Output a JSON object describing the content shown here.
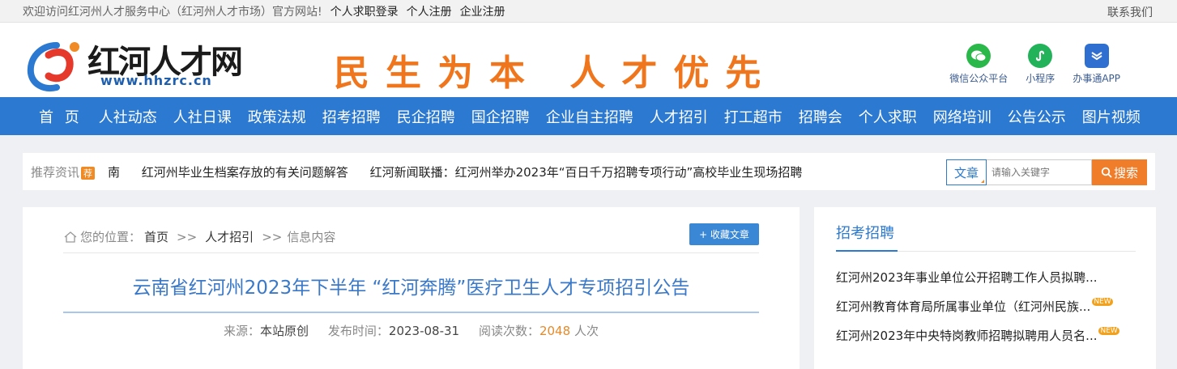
{
  "topbar": {
    "welcome": "欢迎访问红河州人才服务中心（红河州人才市场）官方网站!",
    "links": [
      "个人求职登录",
      "个人注册",
      "企业注册"
    ],
    "contact": "联系我们"
  },
  "header": {
    "logo_name": "红河人才网",
    "logo_site": "www.hhzrc.cn",
    "slogan": "民生为本 人才优先",
    "apps": [
      {
        "label": "微信公众平台",
        "icon": "wechat-icon",
        "color": "#2bb84a"
      },
      {
        "label": "小程序",
        "icon": "mini-program-icon",
        "color": "#22b35a"
      },
      {
        "label": "办事通APP",
        "icon": "app-icon",
        "color": "#2f6fd0"
      }
    ]
  },
  "nav": [
    "首 页",
    "人社动态",
    "人社日课",
    "政策法规",
    "招考招聘",
    "民企招聘",
    "国企招聘",
    "企业自主招聘",
    "人才招引",
    "打工超市",
    "招聘会",
    "个人求职",
    "网络培训",
    "公告公示",
    "图片视频"
  ],
  "recommend": {
    "label": "推荐资讯",
    "tag": "荐",
    "items": [
      "南",
      "红河州毕业生档案存放的有关问题解答",
      "红河新闻联播：红河州举办2023年“百日千万招聘专项行动”高校毕业生现场招聘"
    ]
  },
  "search": {
    "category": "文章",
    "placeholder": "请输入关键字",
    "button": "搜索"
  },
  "article": {
    "breadcrumb_prefix": "您的位置：",
    "breadcrumb": [
      "首页",
      "人才招引",
      "信息内容"
    ],
    "separator": ">>",
    "fav_button": "+ 收藏文章",
    "title": "云南省红河州2023年下半年 “红河奔腾”医疗卫生人才专项招引公告",
    "source_label": "来源：",
    "source": "本站原创",
    "date_label": "发布时间：",
    "date": "2023-08-31",
    "views_label": "阅读次数：",
    "views": "2048",
    "views_unit": "人次"
  },
  "side": {
    "title": "招考招聘",
    "new_tag": "NEW",
    "items": [
      {
        "text": "红河州2023年事业单位公开招聘工作人员拟聘...",
        "new": false
      },
      {
        "text": "红河州教育体育局所属事业单位（红河州民族...",
        "new": true
      },
      {
        "text": "红河州2023年中央特岗教师招聘拟聘用人员名...",
        "new": true
      }
    ]
  }
}
